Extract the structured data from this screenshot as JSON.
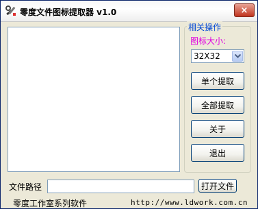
{
  "window": {
    "title": "零度文件图标提取器 v1.0",
    "close_label": "×"
  },
  "options": {
    "group_title": "相关操作",
    "size_label": "图标大小:",
    "size_selected": "32X32"
  },
  "buttons": {
    "extract_one": "单个提取",
    "extract_all": "全部提取",
    "about": "关于",
    "exit": "退出",
    "open_file": "打开文件"
  },
  "path": {
    "label": "文件路径",
    "value": ""
  },
  "status": {
    "left": "零度工作室系列软件",
    "right": "http://www.ldwork.com.cn"
  },
  "colors": {
    "group_title": "#0046d5",
    "size_label": "#e000e0",
    "close_button": "#c1341e"
  }
}
